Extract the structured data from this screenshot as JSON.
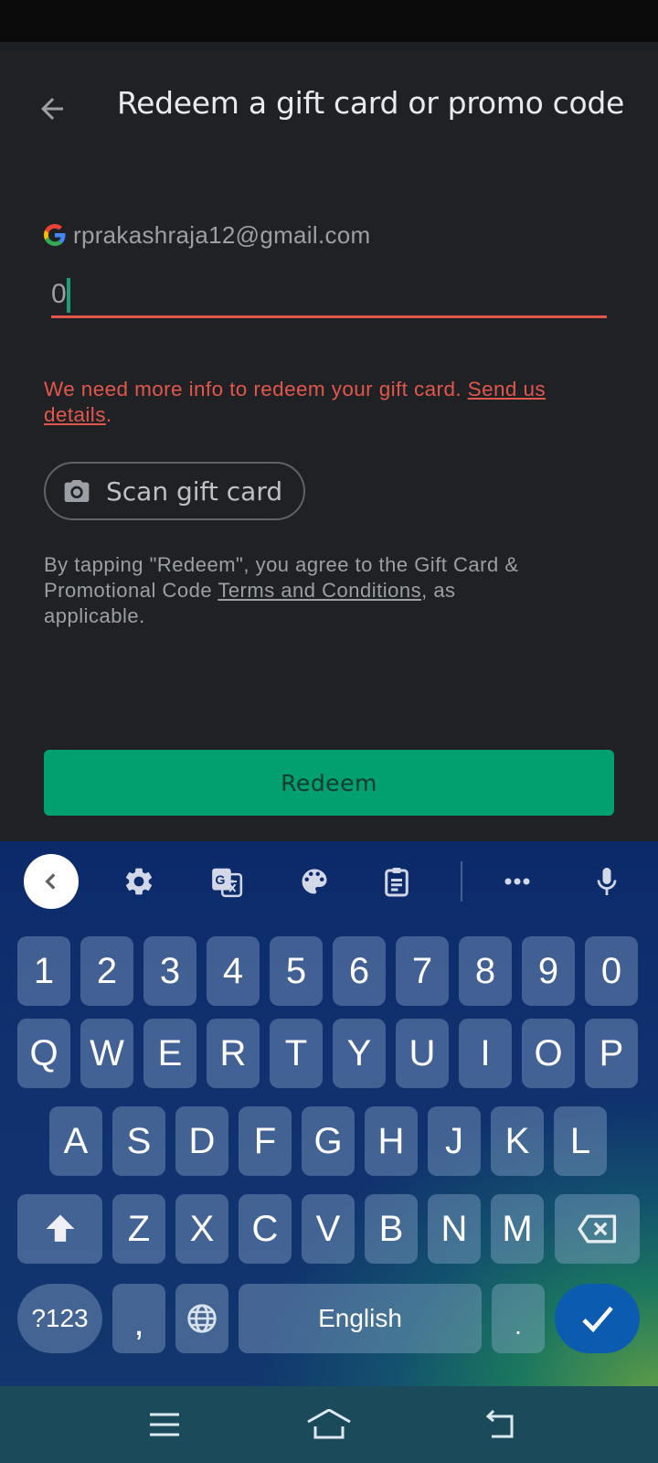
{
  "app": {
    "title": "Redeem a gift card or promo code",
    "account_email": "rprakashraja12@gmail.com",
    "code_input": {
      "value": "0",
      "placeholder": ""
    },
    "error": {
      "message": "We need more info to redeem your gift card. ",
      "link": "Send us details",
      "suffix": "."
    },
    "scan_button_label": "Scan gift card",
    "terms": {
      "prefix": "By tapping \"Redeem\", you agree to the Gift Card & Promotional Code ",
      "link": "Terms and Conditions",
      "suffix": ", as applicable."
    },
    "redeem_button_label": "Redeem",
    "colors": {
      "accent": "#01a06e",
      "error": "#e2574c",
      "background": "#202124"
    }
  },
  "keyboard": {
    "toolbar": [
      "collapse-icon",
      "settings-icon",
      "translate-icon",
      "theme-palette-icon",
      "clipboard-icon",
      "more-icon",
      "microphone-icon"
    ],
    "rows": {
      "numbers": [
        "1",
        "2",
        "3",
        "4",
        "5",
        "6",
        "7",
        "8",
        "9",
        "0"
      ],
      "row1": [
        "Q",
        "W",
        "E",
        "R",
        "T",
        "Y",
        "U",
        "I",
        "O",
        "P"
      ],
      "row2": [
        "A",
        "S",
        "D",
        "F",
        "G",
        "H",
        "J",
        "K",
        "L"
      ],
      "row3": [
        "Z",
        "X",
        "C",
        "V",
        "B",
        "N",
        "M"
      ]
    },
    "symbols_key": "?123",
    "comma_key": ",",
    "space_label": "English",
    "period_key": "."
  },
  "nav_bar": [
    "menu-icon",
    "home-icon",
    "back-icon"
  ]
}
